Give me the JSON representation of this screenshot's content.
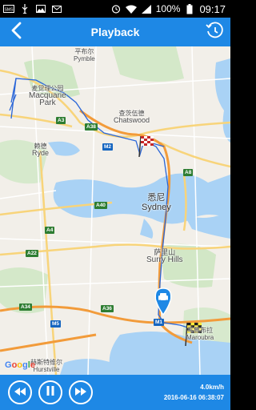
{
  "status_bar": {
    "battery": "100%",
    "time": "09:17",
    "icons": [
      "sim-icon",
      "usb-icon",
      "image-icon",
      "mail-icon",
      "alarm-icon",
      "wifi-icon",
      "signal-icon",
      "battery-icon"
    ]
  },
  "app_bar": {
    "title": "Playback",
    "back_icon": "chevron-left-icon",
    "history_icon": "clock-history-icon"
  },
  "map": {
    "labels": {
      "pymble": "Pymble",
      "pymble_cn": "平布尔",
      "macquarie_cn": "麦觉理公园",
      "macquarie1": "Macquarie",
      "macquarie2": "Park",
      "chatswood_cn": "查茨伍德",
      "chatswood": "Chatswood",
      "ryde_cn": "赖德",
      "ryde": "Ryde",
      "sydney_cn": "悉尼",
      "sydney": "Sydney",
      "surry_cn": "萨里山",
      "surry": "Surry Hills",
      "maroubra_cn": "马鲁布拉",
      "maroubra": "Maroubra",
      "hurstville_cn": "赫斯特维尔",
      "hurstville": "Hurstville"
    },
    "shields": {
      "a3": "A3",
      "a38": "A38",
      "m2": "M2",
      "a8": "A8",
      "a40": "A40",
      "a4": "A4",
      "a22": "A22",
      "a34": "A34",
      "m5": "M5",
      "a36": "A36",
      "m1": "M1"
    },
    "google": [
      "G",
      "o",
      "o",
      "g",
      "l",
      "e"
    ]
  },
  "bottom_bar": {
    "rewind_icon": "rewind-icon",
    "pause_icon": "pause-icon",
    "forward_icon": "fast-forward-icon",
    "speed": "4.0km/h",
    "timestamp": "2016-06-16 06:38:07"
  }
}
